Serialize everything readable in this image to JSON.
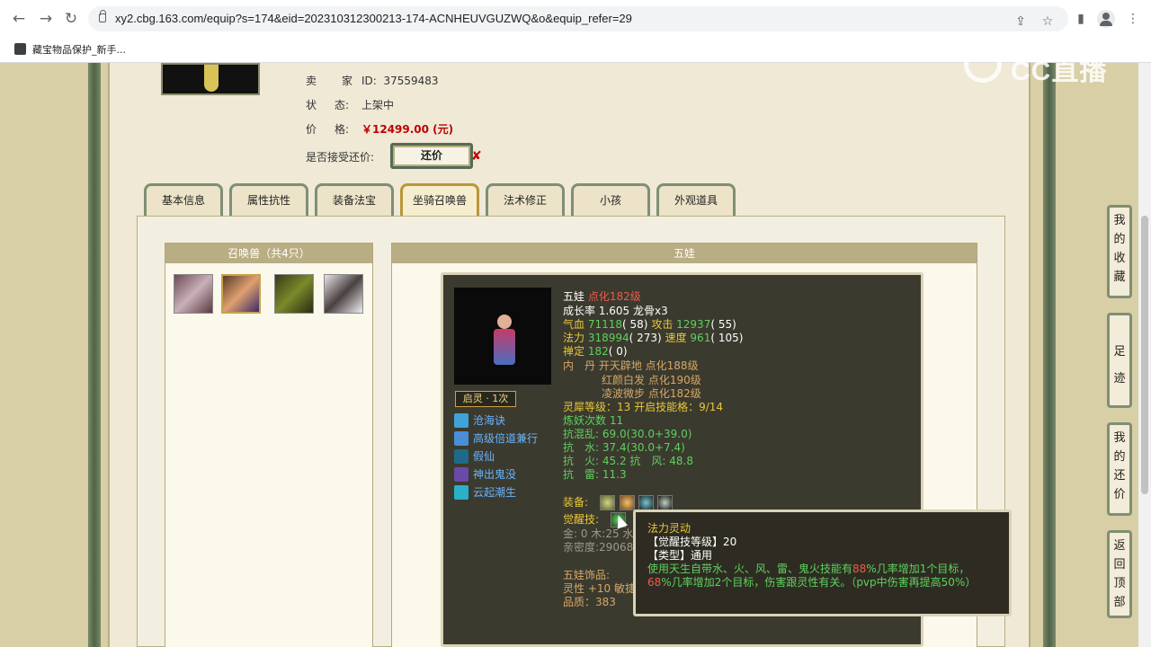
{
  "browser": {
    "url": "xy2.cbg.163.com/equip?s=174&eid=202310312300213-174-ACNHEUVGUZWQ&o&equip_refer=29",
    "bookmark": "藏宝物品保护_新手..."
  },
  "watermark": "CC直播",
  "seller": {
    "seller_key": "卖　家",
    "id_label": "ID:",
    "id_value": "37559483",
    "status_key": "状",
    "status_key2": "态:",
    "status_value": "上架中",
    "price_key": "价",
    "price_key2": "格:",
    "price_value": "￥12499.00 (元)",
    "bargain_label": "是否接受还价:",
    "bargain_button": "还价",
    "bargain_mark": "✘"
  },
  "tabs": [
    "基本信息",
    "属性抗性",
    "装备法宝",
    "坐骑召唤兽",
    "法术修正",
    "小孩",
    "外观道具"
  ],
  "pet_list": {
    "title": "召唤兽（共4只）"
  },
  "detail": {
    "title": "五娃"
  },
  "pet": {
    "name": "五娃",
    "level": "点化182级",
    "growth": "成长率 1.605 龙骨x3",
    "hp_label": "气血",
    "hp": "71118",
    "hp_extra": "( 58)",
    "atk_label": "攻击",
    "atk": "12937",
    "atk_extra": "( 55)",
    "mp_label": "法力",
    "mp": "318994",
    "mp_extra": "( 273)",
    "spd_label": "速度",
    "spd": "961",
    "spd_extra": "( 105)",
    "ding_label": "禅定",
    "ding": "182",
    "ding_extra": "( 0)",
    "neidan_label": "内　丹",
    "neidan1": "开天辟地 点化188级",
    "neidan2": "红颜白发 点化190级",
    "neidan3": "凌波微步 点化182级",
    "lingxi": "灵犀等级：13 开启技能格：9/14",
    "lianyao": "炼妖次数 11",
    "res1": "抗混乱: 69.0(30.0+39.0)",
    "res2": "抗　水: 37.4(30.0+7.4)",
    "res3": "抗　火: 45.2 抗　风: 48.8",
    "res4": "抗　雷: 11.3",
    "equip_label": "装备:",
    "awaken_label": "觉醒技:",
    "elements": "金: 0 木:25 水",
    "intimacy": "亲密度:29068",
    "acc_label": "五娃饰品:",
    "acc_stat": "灵性 +10 敏捷",
    "quality": "品质：383",
    "qiling": "启灵 · 1次",
    "skills": [
      "沧海诀",
      "高级倍道兼行",
      "假仙",
      "神出鬼没",
      "云起潮生"
    ]
  },
  "tooltip": {
    "title": "法力灵动",
    "level": "【觉醒技等级】20",
    "type": "【类型】通用",
    "desc1a": "使用天生自带水、火、风、雷、鬼火技能有",
    "desc1b": "88",
    "desc1c": "%几率增加1个目标，",
    "desc2a": "68",
    "desc2b": "%几率增加2个目标，伤害跟灵性有关。（pvp中伤害再提高50%）"
  },
  "side_buttons": [
    "我的收藏",
    "足迹",
    "我的还价",
    "返回顶部"
  ]
}
